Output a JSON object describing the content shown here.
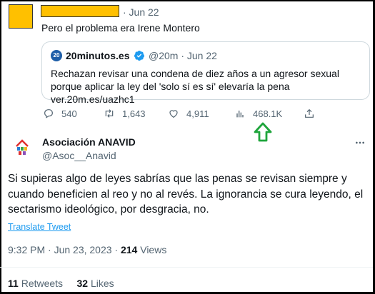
{
  "reply": {
    "date": "· Jun 22",
    "text": "Pero el problema era Irene Montero"
  },
  "quote": {
    "source_name": "20minutos.es",
    "logo_text": "20",
    "handle_date": "@20m · Jun 22",
    "text": "Rechazan revisar una condena de diez años a un agresor sexual porque aplicar la ley del 'solo sí es sí' elevaría la pena ver.20m.es/uazhc1"
  },
  "actions": {
    "replies": "540",
    "retweets": "1,643",
    "likes": "4,911",
    "views": "468.1K"
  },
  "main_tweet": {
    "author_name": "Asociación ANAVID",
    "author_handle": "@Asoc__Anavid",
    "text": "Si supieras algo de leyes sabrías que las penas se revisan siempre y cuando beneficien al reo y no al revés. La ignorancia se cura leyendo, el sectarismo ideológico, por desgracia, no.",
    "translate_label": "Translate Tweet",
    "timestamp": "9:32 PM · Jun 23, 2023 · ",
    "views_count": "214",
    "views_label": " Views"
  },
  "stats": {
    "retweets_count": "11",
    "retweets_label": " Retweets",
    "likes_count": "32",
    "likes_label": " Likes"
  },
  "colors": {
    "redaction": "#ffc000",
    "accent": "#1d9bf0",
    "annotation_arrow": "#1fa53c",
    "secondary_text": "#536471"
  }
}
